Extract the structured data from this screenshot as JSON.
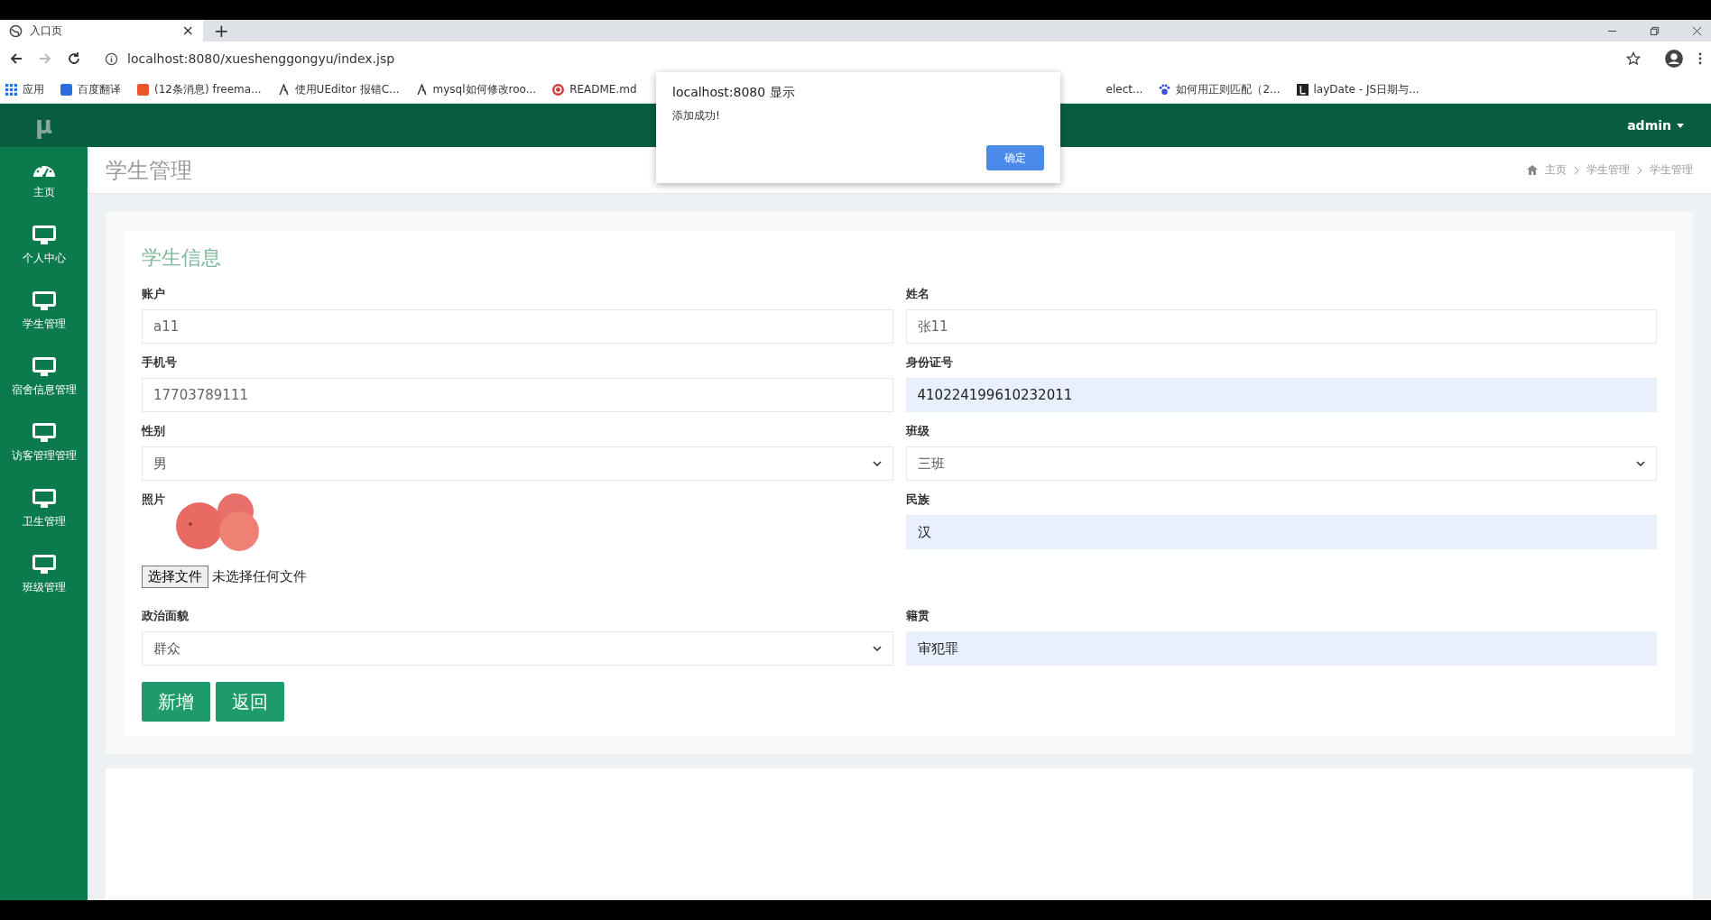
{
  "browser": {
    "tab": {
      "title": "入口页",
      "close": "×"
    },
    "new_tab": "+",
    "url": "localhost:8080/xueshenggongyu/index.jsp",
    "bookmarks_left": [
      {
        "label": "应用",
        "kind": "apps"
      },
      {
        "label": "百度翻译",
        "kind": "translate"
      },
      {
        "label": "(12条消息) freema...",
        "kind": "csdn"
      },
      {
        "label": "使用UEditor 报错C...",
        "kind": "page"
      },
      {
        "label": "mysql如何修改roo...",
        "kind": "page"
      },
      {
        "label": "README.md",
        "kind": "github"
      }
    ],
    "bookmarks_right": [
      {
        "label": "elect...",
        "kind": "none"
      },
      {
        "label": "如何用正则匹配（2...",
        "kind": "paw"
      },
      {
        "label": "layDate - JS日期与...",
        "kind": "lay"
      }
    ]
  },
  "dialog": {
    "title": "localhost:8080 显示",
    "message": "添加成功!",
    "button": "确定"
  },
  "header": {
    "logo": "μ",
    "user": "admin"
  },
  "sidebar": {
    "items": [
      {
        "label": "主页",
        "kind": "gauge"
      },
      {
        "label": "个人中心",
        "kind": "monitor"
      },
      {
        "label": "学生管理",
        "kind": "monitor"
      },
      {
        "label": "宿舍信息管理",
        "kind": "monitor"
      },
      {
        "label": "访客管理管理",
        "kind": "monitor"
      },
      {
        "label": "卫生管理",
        "kind": "monitor"
      },
      {
        "label": "班级管理",
        "kind": "monitor"
      }
    ]
  },
  "page": {
    "title": "学生管理",
    "breadcrumb": [
      "主页",
      "学生管理",
      "学生管理"
    ]
  },
  "form": {
    "title": "学生信息",
    "fields": [
      {
        "label": "账户",
        "kind": "text",
        "value": "a11",
        "autofilled": false
      },
      {
        "label": "姓名",
        "kind": "text",
        "value": "张11",
        "autofilled": false
      },
      {
        "label": "手机号",
        "kind": "text",
        "value": "17703789111",
        "autofilled": false
      },
      {
        "label": "身份证号",
        "kind": "text",
        "value": "410224199610232011",
        "autofilled": true
      },
      {
        "label": "性别",
        "kind": "select",
        "value": "男",
        "autofilled": false
      },
      {
        "label": "班级",
        "kind": "select",
        "value": "三班",
        "autofilled": false
      },
      {
        "label": "照片",
        "kind": "photo",
        "button": "选择文件",
        "file_status": "未选择任何文件"
      },
      {
        "label": "民族",
        "kind": "text",
        "value": "汉",
        "autofilled": true
      },
      {
        "label": "政治面貌",
        "kind": "select",
        "value": "群众",
        "autofilled": false
      },
      {
        "label": "籍贯",
        "kind": "text",
        "value": "审犯罪",
        "autofilled": true
      }
    ],
    "buttons": [
      "新增",
      "返回"
    ]
  }
}
